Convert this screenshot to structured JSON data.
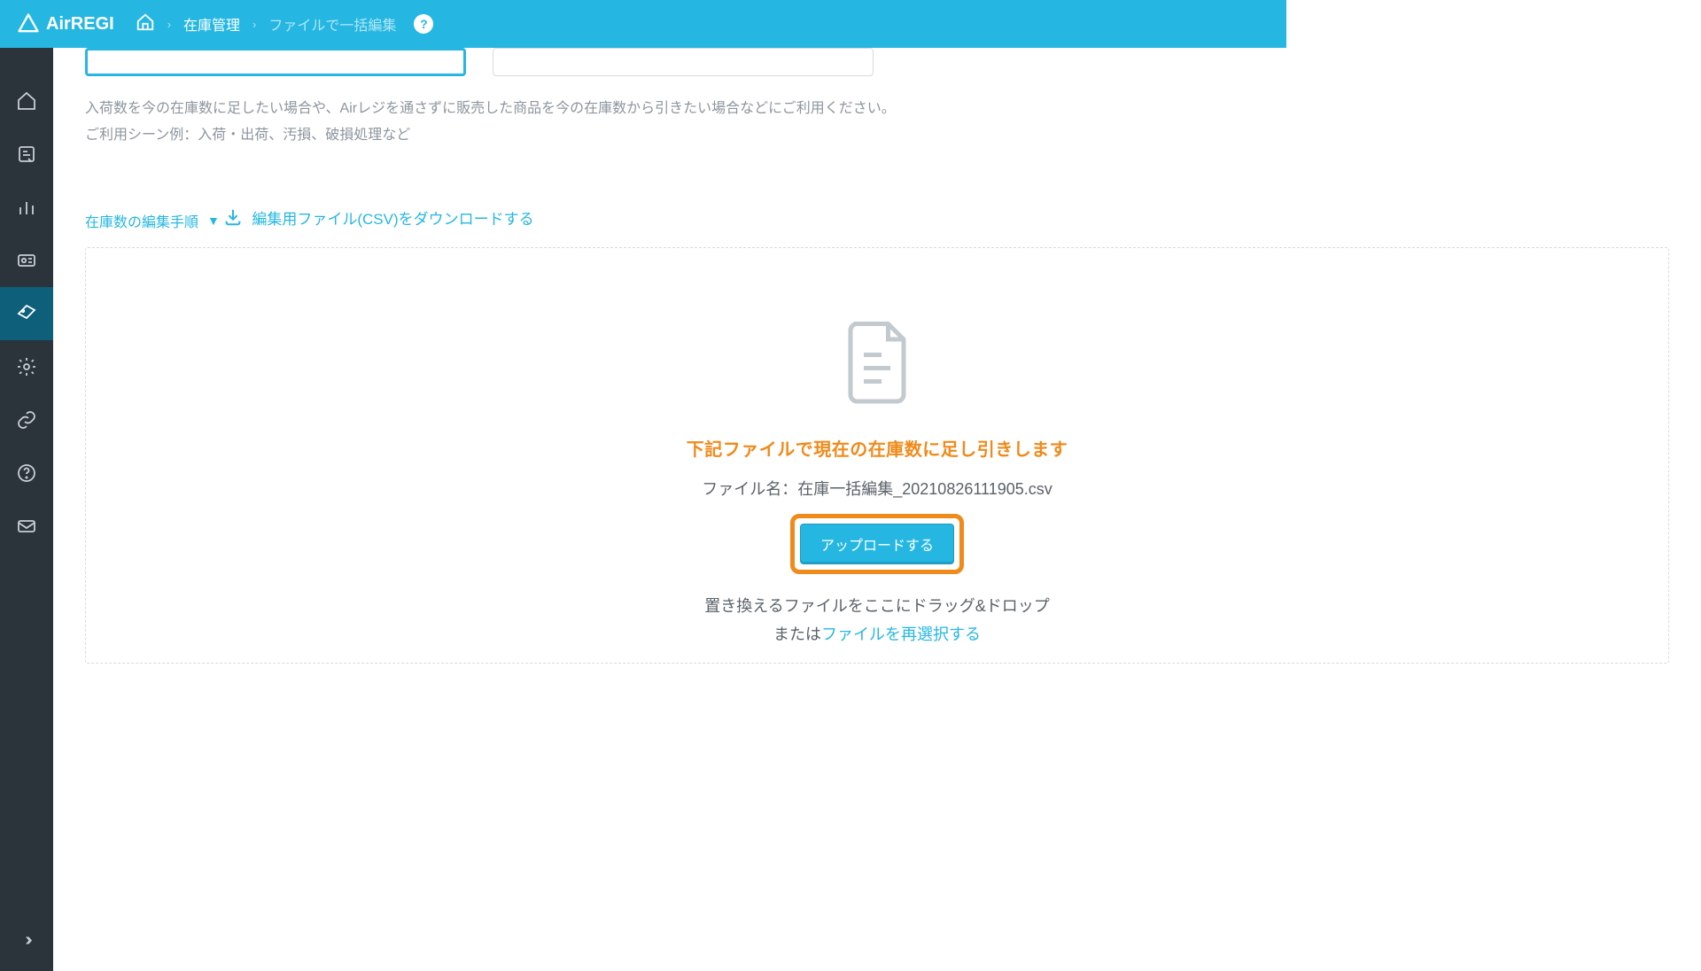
{
  "brand": "AirREGI",
  "breadcrumb": {
    "item1": "在庫管理",
    "item2": "ファイルで一括編集"
  },
  "description": {
    "line1": "入荷数を今の在庫数に足したい場合や、Airレジを通さずに販売した商品を今の在庫数から引きたい場合などにご利用ください。",
    "line2": "ご利用シーン例：入荷・出荷、汚損、破損処理など"
  },
  "steps_link": "在庫数の編集手順",
  "download_link": "編集用ファイル(CSV)をダウンロードする",
  "dropzone": {
    "title": "下記ファイルで現在の在庫数に足し引きします",
    "filename_label": "ファイル名：",
    "filename": "在庫一括編集_20210826111905.csv",
    "upload_button": "アップロードする",
    "drag_text": "置き換えるファイルをここにドラッグ&ドロップ",
    "or_text": "または",
    "reselect_link": "ファイルを再選択する"
  },
  "help_badge": "?"
}
